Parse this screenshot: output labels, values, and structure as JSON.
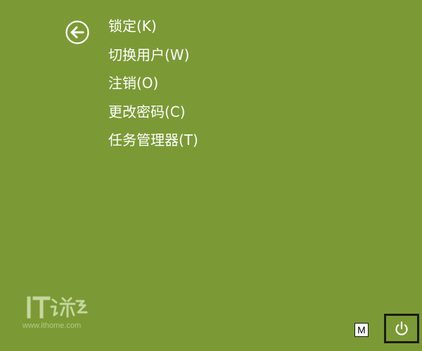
{
  "menu": {
    "items": [
      {
        "label": "锁定(K)"
      },
      {
        "label": "切换用户(W)"
      },
      {
        "label": "注销(O)"
      },
      {
        "label": "更改密码(C)"
      },
      {
        "label": "任务管理器(T)"
      }
    ]
  },
  "icons": {
    "back": "back-arrow-circle-icon",
    "power": "power-icon"
  },
  "taskbar": {
    "ime_label": "M"
  },
  "watermark": {
    "logo_text": "IT之家",
    "url": "www.ithome.com"
  },
  "colors": {
    "background": "#7b9a35",
    "text": "#ffffff"
  }
}
